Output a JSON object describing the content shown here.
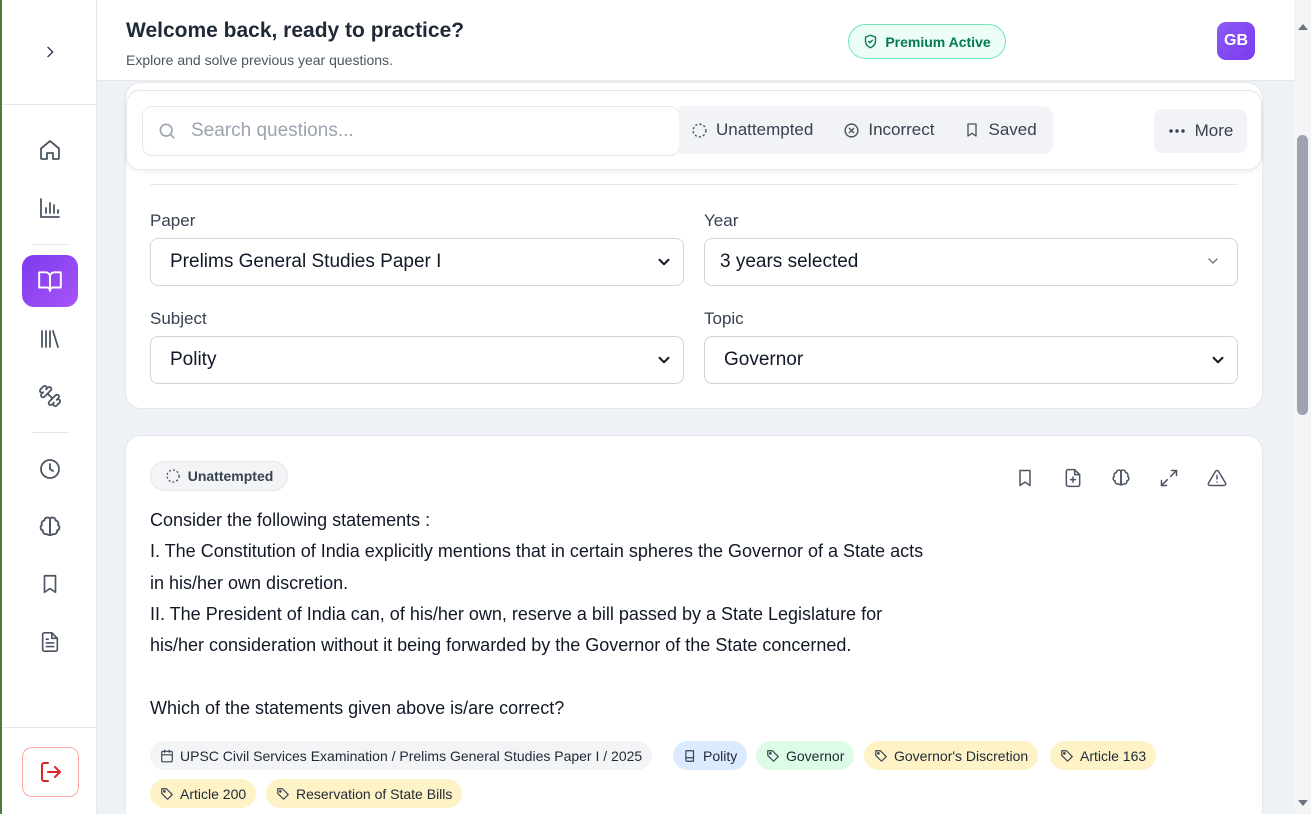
{
  "header": {
    "welcome": "Welcome back, ready to practice?",
    "subtitle": "Explore and solve previous year questions.",
    "premium_label": "Premium Active",
    "avatar_initials": "GB"
  },
  "sidebar": {
    "items": [
      {
        "name": "home",
        "icon": "home-icon"
      },
      {
        "name": "analytics",
        "icon": "bar-chart-icon"
      },
      {
        "name": "pyq",
        "icon": "book-open-icon",
        "active": true
      },
      {
        "name": "library",
        "icon": "library-icon"
      },
      {
        "name": "practice",
        "icon": "dumbbell-icon"
      },
      {
        "name": "history",
        "icon": "clock-icon"
      },
      {
        "name": "ai",
        "icon": "brain-icon"
      },
      {
        "name": "saved",
        "icon": "bookmark-icon"
      },
      {
        "name": "notes",
        "icon": "file-text-icon"
      }
    ],
    "logout_icon": "logout-icon"
  },
  "search": {
    "placeholder": "Search questions...",
    "value": ""
  },
  "quick_filters": [
    {
      "label": "Unattempted",
      "icon": "dashed-circle-icon"
    },
    {
      "label": "Incorrect",
      "icon": "x-circle-icon"
    },
    {
      "label": "Saved",
      "icon": "bookmark-icon"
    }
  ],
  "more_label": "More",
  "filters": {
    "paper": {
      "label": "Paper",
      "value": "Prelims General Studies Paper I"
    },
    "year": {
      "label": "Year",
      "value": "3 years selected"
    },
    "subject": {
      "label": "Subject",
      "value": "Polity"
    },
    "topic": {
      "label": "Topic",
      "value": "Governor"
    }
  },
  "question": {
    "status": "Unattempted",
    "lines": [
      "Consider the following statements :",
      "I. The Constitution of India explicitly mentions that in certain spheres the Governor of a State acts",
      "in his/her own discretion.",
      "II. The President of India can, of his/her own, reserve a bill passed by a State Legislature for",
      "his/her consideration without it being forwarded by the Governor of the State concerned.",
      "",
      "Which of the statements given above is/are correct?"
    ],
    "tags": {
      "source": "UPSC Civil Services Examination / Prelims General Studies Paper I / 2025",
      "subject": "Polity",
      "topic": "Governor",
      "keywords": [
        "Governor's Discretion",
        "Article 163",
        "Article 200",
        "Reservation of State Bills"
      ]
    }
  },
  "colors": {
    "accent": "#7c3aed",
    "premium_green": "#047857",
    "logout_red": "#dc2626"
  }
}
